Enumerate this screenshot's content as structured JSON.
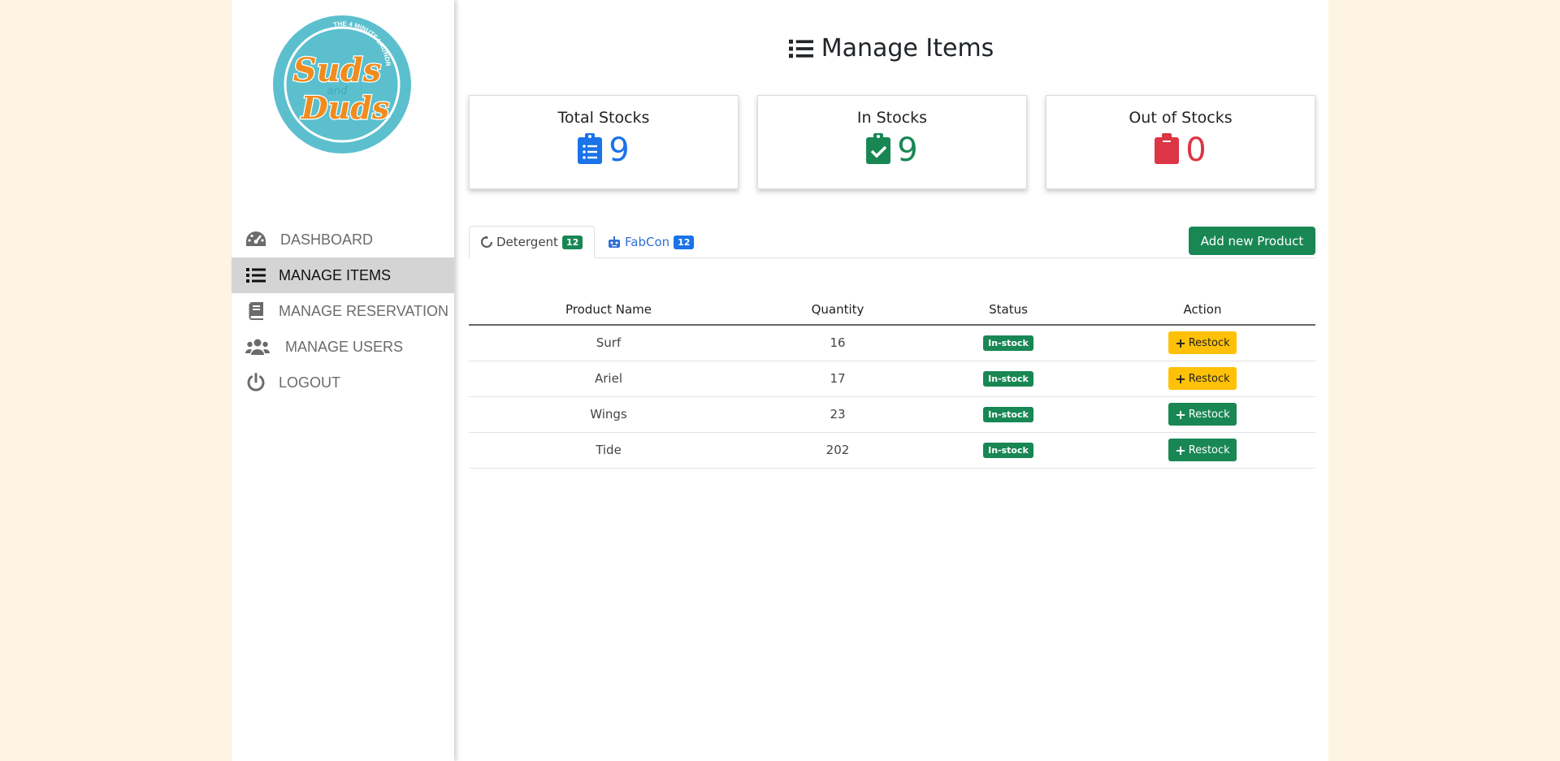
{
  "colors": {
    "page_bg": "#fdf4e3",
    "primary": "#1a73e8",
    "success": "#198754",
    "danger": "#dc3545",
    "warning": "#ffc107"
  },
  "logo": {
    "tagline": "THE 4 MINUTE LAUNDRY",
    "line1": "Suds",
    "line2": "and",
    "line3": "Duds"
  },
  "sidebar": {
    "items": [
      {
        "label": "DASHBOARD",
        "icon": "gauge-icon",
        "active": false
      },
      {
        "label": "MANAGE ITEMS",
        "icon": "list-icon",
        "active": true
      },
      {
        "label": "MANAGE RESERVATION",
        "icon": "book-icon",
        "active": false
      },
      {
        "label": "MANAGE USERS",
        "icon": "users-icon",
        "active": false
      },
      {
        "label": "LOGOUT",
        "icon": "power-icon",
        "active": false
      }
    ]
  },
  "page": {
    "title": "Manage Items",
    "title_icon": "list-icon"
  },
  "cards": [
    {
      "title": "Total Stocks",
      "value": "9",
      "icon": "clipboard-list-icon",
      "color": "#1a73e8"
    },
    {
      "title": "In Stocks",
      "value": "9",
      "icon": "clipboard-check-icon",
      "color": "#198754"
    },
    {
      "title": "Out of Stocks",
      "value": "0",
      "icon": "clipboard-icon",
      "color": "#dc3545"
    }
  ],
  "tabs": [
    {
      "label": "Detergent",
      "count": "12",
      "icon": "spinner-icon",
      "active": true
    },
    {
      "label": "FabCon",
      "count": "12",
      "icon": "robot-icon",
      "active": false
    }
  ],
  "add_button": {
    "label": "Add new Product"
  },
  "table": {
    "headers": [
      "Product Name",
      "Quantity",
      "Status",
      "Action"
    ],
    "rows": [
      {
        "name": "Surf",
        "quantity": "16",
        "status": "In-stock",
        "action": "Restock",
        "action_style": "warning"
      },
      {
        "name": "Ariel",
        "quantity": "17",
        "status": "In-stock",
        "action": "Restock",
        "action_style": "warning"
      },
      {
        "name": "Wings",
        "quantity": "23",
        "status": "In-stock",
        "action": "Restock",
        "action_style": "success"
      },
      {
        "name": "Tide",
        "quantity": "202",
        "status": "In-stock",
        "action": "Restock",
        "action_style": "success"
      }
    ]
  }
}
